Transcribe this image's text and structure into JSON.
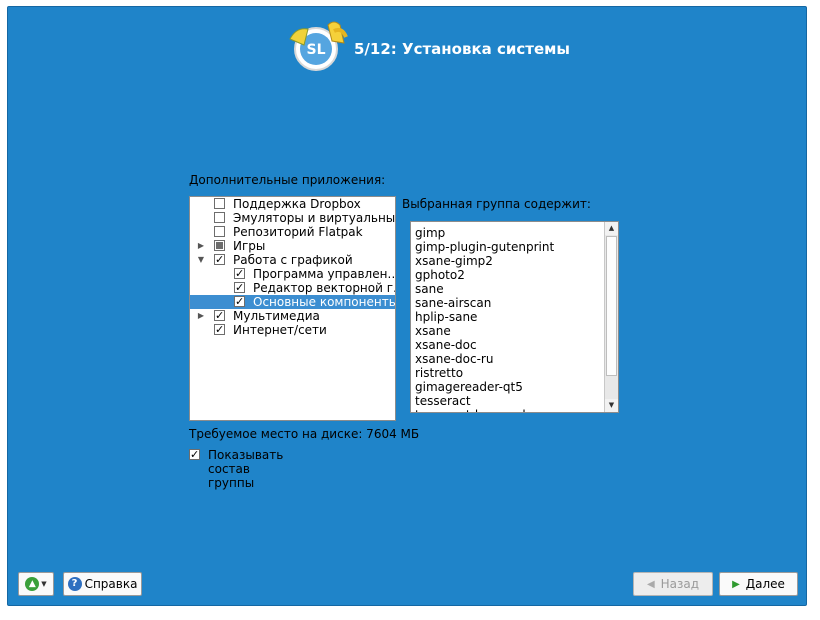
{
  "header": {
    "title": "5/12: Установка системы",
    "logo_text": "SL"
  },
  "extra_apps": {
    "label": "Дополнительные приложения:",
    "items": [
      {
        "label": "Поддержка Dropbox",
        "state": "unchecked"
      },
      {
        "label": "Эмуляторы и виртуальны…",
        "state": "unchecked"
      },
      {
        "label": "Репозиторий Flatpak",
        "state": "unchecked"
      },
      {
        "label": "Игры",
        "state": "partial",
        "expander": "collapsed"
      },
      {
        "label": "Работа с графикой",
        "state": "checked",
        "expander": "expanded"
      },
      {
        "label": "Программа управлен…",
        "state": "checked"
      },
      {
        "label": "Редактор векторной г…",
        "state": "checked"
      },
      {
        "label": "Основные компоненты",
        "state": "checked",
        "selected": true
      },
      {
        "label": "Мультимедиа",
        "state": "checked",
        "expander": "collapsed"
      },
      {
        "label": "Интернет/сети",
        "state": "checked"
      }
    ],
    "check_mark": "✓"
  },
  "group_contents": {
    "label": "Выбранная группа содержит:",
    "packages": [
      "gimp",
      "gimp-plugin-gutenprint",
      "xsane-gimp2",
      "gphoto2",
      "sane",
      "sane-airscan",
      "hplip-sane",
      "xsane",
      "xsane-doc",
      "xsane-doc-ru",
      "ristretto",
      "gimagereader-qt5",
      "tesseract",
      "tesseract-langpack-ru"
    ]
  },
  "disk_space": "Требуемое место на диске: 7604 МБ",
  "show_group": {
    "label": "Показывать состав группы",
    "checked": true
  },
  "buttons": {
    "help": "Справка",
    "back": "Назад",
    "next": "Далее"
  },
  "colors": {
    "background": "#1f84c9",
    "selection": "#3c8ed1"
  }
}
